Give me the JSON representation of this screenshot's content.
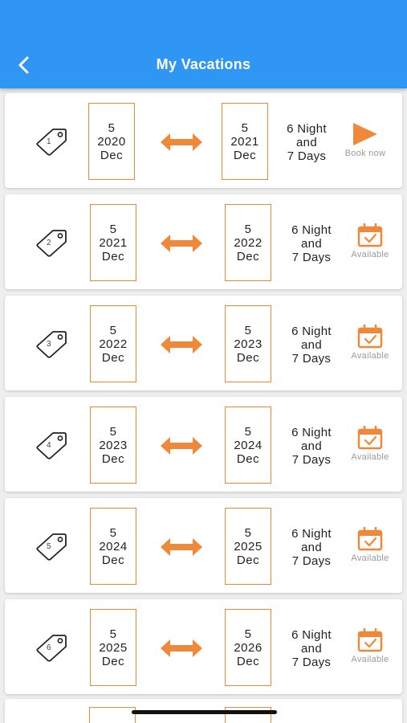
{
  "header": {
    "title": "My Vacations",
    "back_icon": "back-chevron-icon"
  },
  "colors": {
    "appbar": "#2f96f3",
    "accent": "#f0883a",
    "label_gray": "#9a9a9a"
  },
  "vacations": [
    {
      "tag_number": "1",
      "start": {
        "day": "5",
        "year": "2020",
        "month": "Dec"
      },
      "end": {
        "day": "5",
        "year": "2021",
        "month": "Dec"
      },
      "duration": [
        "6 Night",
        "and",
        "7 Days"
      ],
      "action": {
        "icon": "play-icon",
        "label": "Book now"
      }
    },
    {
      "tag_number": "2",
      "start": {
        "day": "5",
        "year": "2021",
        "month": "Dec"
      },
      "end": {
        "day": "5",
        "year": "2022",
        "month": "Dec"
      },
      "duration": [
        "6 Night",
        "and",
        "7 Days"
      ],
      "action": {
        "icon": "calendar-check-icon",
        "label": "Available"
      }
    },
    {
      "tag_number": "3",
      "start": {
        "day": "5",
        "year": "2022",
        "month": "Dec"
      },
      "end": {
        "day": "5",
        "year": "2023",
        "month": "Dec"
      },
      "duration": [
        "6 Night",
        "and",
        "7 Days"
      ],
      "action": {
        "icon": "calendar-check-icon",
        "label": "Available"
      }
    },
    {
      "tag_number": "4",
      "start": {
        "day": "5",
        "year": "2023",
        "month": "Dec"
      },
      "end": {
        "day": "5",
        "year": "2024",
        "month": "Dec"
      },
      "duration": [
        "6 Night",
        "and",
        "7 Days"
      ],
      "action": {
        "icon": "calendar-check-icon",
        "label": "Available"
      }
    },
    {
      "tag_number": "5",
      "start": {
        "day": "5",
        "year": "2024",
        "month": "Dec"
      },
      "end": {
        "day": "5",
        "year": "2025",
        "month": "Dec"
      },
      "duration": [
        "6 Night",
        "and",
        "7 Days"
      ],
      "action": {
        "icon": "calendar-check-icon",
        "label": "Available"
      }
    },
    {
      "tag_number": "6",
      "start": {
        "day": "5",
        "year": "2025",
        "month": "Dec"
      },
      "end": {
        "day": "5",
        "year": "2026",
        "month": "Dec"
      },
      "duration": [
        "6 Night",
        "and",
        "7 Days"
      ],
      "action": {
        "icon": "calendar-check-icon",
        "label": "Available"
      }
    }
  ]
}
